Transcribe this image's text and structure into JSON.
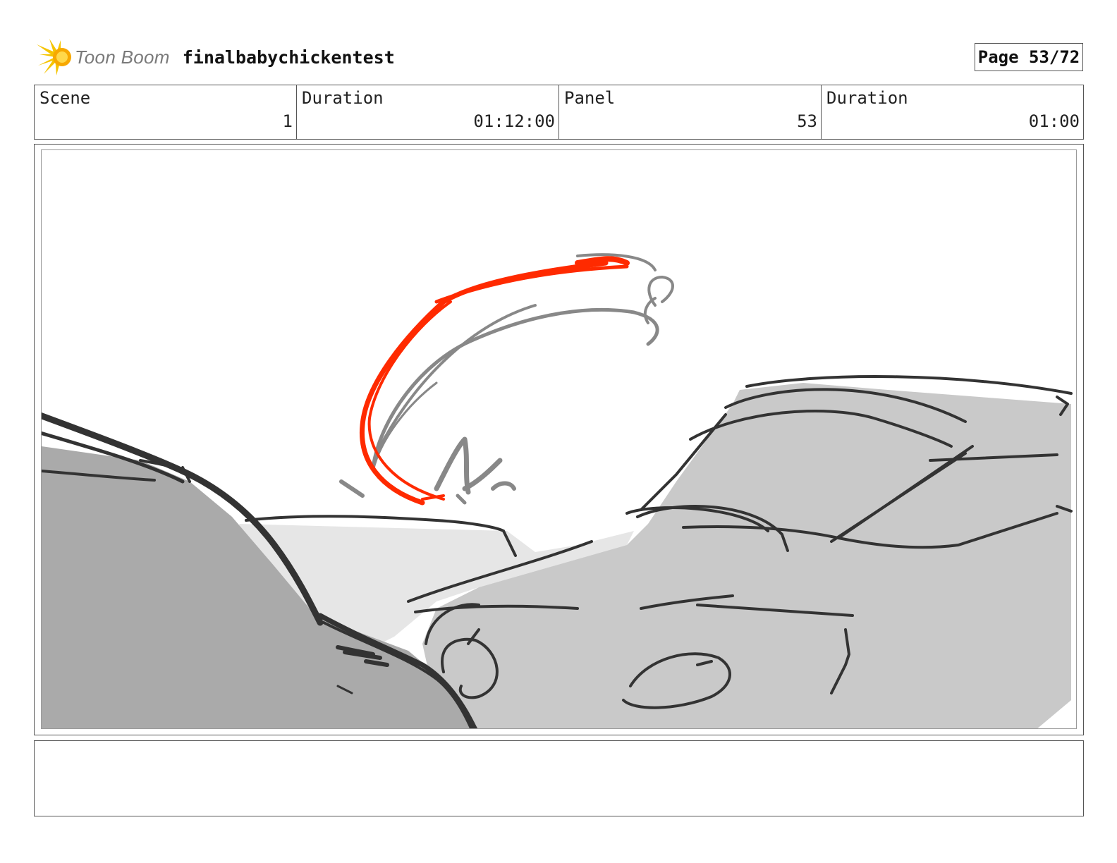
{
  "header": {
    "logo_text": "Toon Boom",
    "project_title": "finalbabychickentest",
    "page_label": "Page 53/72"
  },
  "info": {
    "scene_label": "Scene",
    "scene_value": "1",
    "scene_duration_label": "Duration",
    "scene_duration_value": "01:12:00",
    "panel_label": "Panel",
    "panel_value": "53",
    "panel_duration_label": "Duration",
    "panel_duration_value": "01:00"
  },
  "colors": {
    "sketch_dark": "#333333",
    "sketch_gray": "#888888",
    "fill_gray": "#c9c9c9",
    "fill_dark": "#aaaaaa",
    "accent_red": "#ff2a00",
    "logo_yellow": "#f5c400"
  },
  "notes": {
    "text": ""
  }
}
